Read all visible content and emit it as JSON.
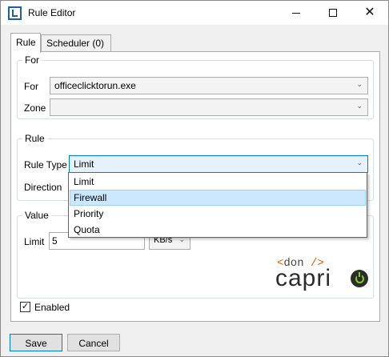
{
  "window": {
    "title": "Rule Editor"
  },
  "tabs": [
    {
      "label": "Rule"
    },
    {
      "label": "Scheduler (0)"
    }
  ],
  "for_group": {
    "title": "For",
    "for_label": "For",
    "for_value": "officeclicktorun.exe",
    "zone_label": "Zone",
    "zone_value": ""
  },
  "rule_group": {
    "title": "Rule",
    "rule_type_label": "Rule Type",
    "rule_type_value": "Limit",
    "direction_label": "Direction"
  },
  "rule_type_options": [
    {
      "label": "Limit",
      "selected": false
    },
    {
      "label": "Firewall",
      "selected": true
    },
    {
      "label": "Priority",
      "selected": false
    },
    {
      "label": "Quota",
      "selected": false
    }
  ],
  "value_group": {
    "title": "Value",
    "limit_label": "Limit",
    "limit_value": "5",
    "unit_value": "KB/s"
  },
  "logo": {
    "top": "<don />",
    "bottom": "capri"
  },
  "enabled": {
    "label": "Enabled",
    "checked": true
  },
  "buttons": {
    "save": "Save",
    "cancel": "Cancel"
  }
}
